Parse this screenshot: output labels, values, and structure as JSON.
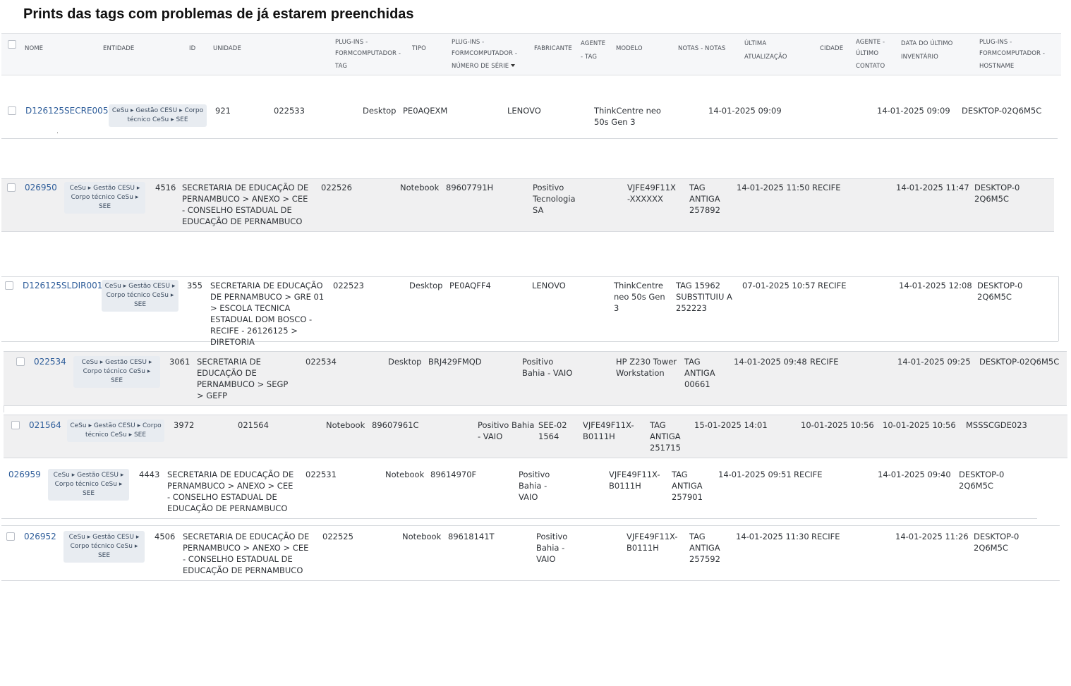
{
  "page": {
    "title": "Prints das tags com problemas de já estarem preenchidas"
  },
  "header": {
    "nome": "NOME",
    "entidade": "ENTIDADE",
    "id": "ID",
    "unidade": "UNIDADE",
    "tag": [
      "PLUG-INS -",
      "FORMCOMPUTADOR -",
      "TAG"
    ],
    "tipo": "TIPO",
    "serie": [
      "PLUG-INS -",
      "FORMCOMPUTADOR -",
      "NÚMERO DE SÉRIE"
    ],
    "fabricante": "FABRICANTE",
    "agente_tag": [
      "AGENTE",
      "- TAG"
    ],
    "modelo": "MODELO",
    "notas": "NOTAS - NOTAS",
    "ultima": [
      "ÚLTIMA",
      "ATUALIZAÇÃO"
    ],
    "cidade": "CIDADE",
    "agente_contato": [
      "AGENTE -",
      "ÚLTIMO",
      "CONTATO"
    ],
    "inventario": [
      "DATA DO ÚLTIMO",
      "INVENTÁRIO"
    ],
    "hostname": [
      "PLUG-INS -",
      "FORMCOMPUTADOR -",
      "HOSTNAME"
    ]
  },
  "rows": [
    {
      "nome": "D126125SECRE005",
      "entidade": "CeSu ▸ Gestão CESU ▸ Corpo técnico CeSu ▸ SEE",
      "id": "921",
      "unidade": "",
      "tag": "022533",
      "tipo": "Desktop",
      "serie": "PE0AQEXM",
      "fabricante": "LENOVO",
      "agente_tag": "",
      "modelo": "ThinkCentre neo 50s Gen 3",
      "notas": "",
      "ultima": "14-01-2025 09:09",
      "cidade": "",
      "contato": "",
      "inventario": "14-01-2025 09:09",
      "hostname": "DESKTOP-02Q6M5C"
    },
    {
      "nome": "026950",
      "entidade": "CeSu ▸ Gestão CESU ▸ Corpo técnico CeSu ▸ SEE",
      "id": "4516",
      "unidade": "SECRETARIA DE EDUCAÇÃO DE PERNAMBUCO > ANEXO > CEE - CONSELHO ESTADUAL DE EDUCAÇÃO DE PERNAMBUCO",
      "tag": "022526",
      "tipo": "Notebook",
      "serie": "89607791H",
      "fabricante": "Positivo Tecnologia SA",
      "agente_tag": "",
      "modelo": "VJFE49F11X-XXXXXX",
      "notas": "TAG ANTIGA 257892",
      "ultima": "14-01-2025 11:50",
      "cidade": "RECIFE",
      "contato": "",
      "inventario": "14-01-2025 11:47",
      "hostname": "DESKTOP-02Q6M5C"
    },
    {
      "nome": "D126125SLDIR001",
      "entidade": "CeSu ▸ Gestão CESU ▸ Corpo técnico CeSu ▸ SEE",
      "id": "355",
      "unidade": "SECRETARIA DE EDUCAÇÃO DE PERNAMBUCO > GRE 01 > ESCOLA TECNICA ESTADUAL DOM BOSCO - RECIFE - 26126125 > DIRETORIA",
      "tag": "022523",
      "tipo": "Desktop",
      "serie": "PE0AQFF4",
      "fabricante": "LENOVO",
      "agente_tag": "",
      "modelo": "ThinkCentre neo 50s Gen 3",
      "notas": "TAG 15962 SUBSTITUIU A 252223",
      "ultima": "07-01-2025 10:57",
      "cidade": "RECIFE",
      "contato": "",
      "inventario": "14-01-2025 12:08",
      "hostname": "DESKTOP-02Q6M5C"
    },
    {
      "nome": "022534",
      "entidade": "CeSu ▸ Gestão CESU ▸ Corpo técnico CeSu ▸ SEE",
      "id": "3061",
      "unidade": "SECRETARIA DE EDUCAÇÃO DE PERNAMBUCO > SEGP > GEFP",
      "tag": "022534",
      "tipo": "Desktop",
      "serie": "BRJ429FMQD",
      "fabricante": "Positivo Bahia - VAIO",
      "agente_tag": "",
      "modelo": "HP Z230 Tower Workstation",
      "notas": "TAG ANTIGA 00661",
      "ultima": "14-01-2025 09:48",
      "cidade": "RECIFE",
      "contato": "",
      "inventario": "14-01-2025 09:25",
      "hostname": "DESKTOP-02Q6M5C"
    },
    {
      "nome": "021564",
      "entidade": "CeSu ▸ Gestão CESU ▸ Corpo técnico CeSu ▸ SEE",
      "id": "3972",
      "unidade": "",
      "tag": "021564",
      "tipo": "Notebook",
      "serie": "89607961C",
      "fabricante": "Positivo Bahia - VAIO",
      "agente_tag": "SEE-021564",
      "modelo": "VJFE49F11X-B0111H",
      "notas": "TAG ANTIGA 251715",
      "ultima": "15-01-2025 14:01",
      "cidade": "",
      "contato": "10-01-2025 10:56",
      "inventario": "10-01-2025 10:56",
      "hostname": "MSSSCGDE023"
    },
    {
      "nome": "026959",
      "entidade": "CeSu ▸ Gestão CESU ▸ Corpo técnico CeSu ▸ SEE",
      "id": "4443",
      "unidade": "SECRETARIA DE EDUCAÇÃO DE PERNAMBUCO > ANEXO > CEE - CONSELHO ESTADUAL DE EDUCAÇÃO DE PERNAMBUCO",
      "tag": "022531",
      "tipo": "Notebook",
      "serie": "89614970F",
      "fabricante": "Positivo Bahia - VAIO",
      "agente_tag": "",
      "modelo": "VJFE49F11X-B0111H",
      "notas": "TAG ANTIGA 257901",
      "ultima": "14-01-2025 09:51",
      "cidade": "RECIFE",
      "contato": "",
      "inventario": "14-01-2025 09:40",
      "hostname": "DESKTOP-02Q6M5C"
    },
    {
      "nome": "026952",
      "entidade": "CeSu ▸ Gestão CESU ▸ Corpo técnico CeSu ▸ SEE",
      "id": "4506",
      "unidade": "SECRETARIA DE EDUCAÇÃO DE PERNAMBUCO > ANEXO > CEE - CONSELHO ESTADUAL DE EDUCAÇÃO DE PERNAMBUCO",
      "tag": "022525",
      "tipo": "Notebook",
      "serie": "89618141T",
      "fabricante": "Positivo Bahia - VAIO",
      "agente_tag": "",
      "modelo": "VJFE49F11X-B0111H",
      "notas": "TAG ANTIGA 257592",
      "ultima": "14-01-2025 11:30",
      "cidade": "RECIFE",
      "contato": "",
      "inventario": "14-01-2025 11:26",
      "hostname": "DESKTOP-02Q6M5C"
    }
  ]
}
